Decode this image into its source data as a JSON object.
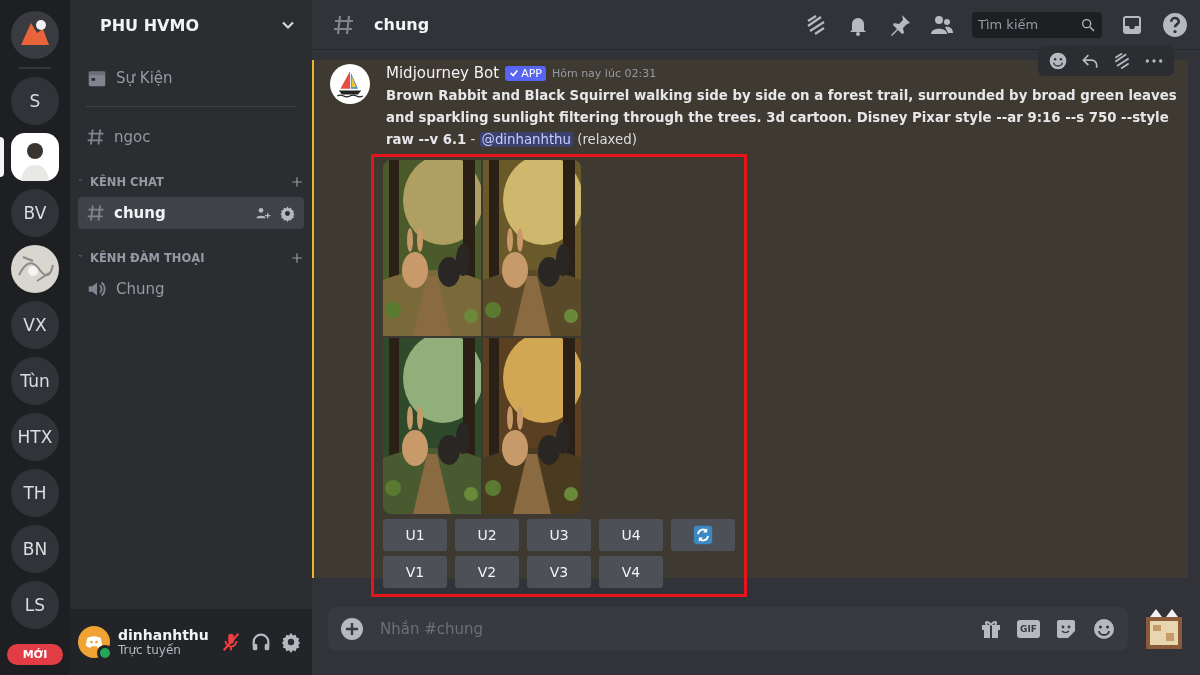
{
  "server_rail": {
    "items": [
      {
        "kind": "picture",
        "selected": false
      },
      {
        "kind": "divider"
      },
      {
        "kind": "text",
        "label": "S",
        "selected": false
      },
      {
        "kind": "picture",
        "selected": true
      },
      {
        "kind": "text",
        "label": "BV",
        "selected": false
      },
      {
        "kind": "picture",
        "selected": false
      },
      {
        "kind": "text",
        "label": "VX",
        "selected": false
      },
      {
        "kind": "text",
        "label": "Tùn",
        "selected": false
      },
      {
        "kind": "text",
        "label": "HTX",
        "selected": false
      },
      {
        "kind": "text",
        "label": "TH",
        "selected": false
      },
      {
        "kind": "text",
        "label": "BN",
        "selected": false
      },
      {
        "kind": "text",
        "label": "LS",
        "selected": false
      }
    ],
    "new_badge": "MỚI"
  },
  "sidebar": {
    "server_name": "PHU HVMO",
    "items": [
      {
        "kind": "events",
        "label": "Sự Kiện"
      },
      {
        "kind": "divider"
      },
      {
        "kind": "text_channel",
        "label": "ngoc",
        "selected": false
      },
      {
        "kind": "category",
        "label": "KÊNH CHAT",
        "expanded": true,
        "children": [
          {
            "kind": "text_channel",
            "label": "chung",
            "selected": true
          }
        ]
      },
      {
        "kind": "category",
        "label": "KÊNH ĐÀM THOẠI",
        "expanded": true,
        "children": [
          {
            "kind": "voice_channel",
            "label": "Chung",
            "selected": false
          }
        ]
      }
    ]
  },
  "user_panel": {
    "name": "dinhanhthu",
    "status": "Trực tuyến",
    "online": true,
    "mic_muted": true
  },
  "header": {
    "channel": "chung",
    "search": {
      "placeholder": "Tìm kiếm"
    }
  },
  "message": {
    "highlighted": true,
    "author": "Midjourney Bot",
    "badge": "APP",
    "time": "Hôm nay lúc 02:31",
    "content": "**Brown Rabbit and Black Squirrel walking side by side on a forest trail, surrounded by broad green leaves and sparkling sunlight filtering through the trees. 3d cartoon. Disney Pixar style --ar 9:16 --s 750 --style raw --v 6.1** -",
    "mention": "@dinhanhthu",
    "suffix": "(relaxed)",
    "images": [
      {
        "kind": "picture"
      },
      {
        "kind": "picture"
      },
      {
        "kind": "picture"
      },
      {
        "kind": "picture"
      }
    ],
    "buttons": [
      [
        {
          "kind": "text",
          "label": "U1"
        },
        {
          "kind": "text",
          "label": "U2"
        },
        {
          "kind": "text",
          "label": "U3"
        },
        {
          "kind": "text",
          "label": "U4"
        },
        {
          "kind": "reroll"
        }
      ],
      [
        {
          "kind": "text",
          "label": "V1"
        },
        {
          "kind": "text",
          "label": "V2"
        },
        {
          "kind": "text",
          "label": "V3"
        },
        {
          "kind": "text",
          "label": "V4"
        }
      ]
    ],
    "highlight_frame": true
  },
  "composer": {
    "placeholder": "Nhắn #chung",
    "gif_label": "GIF"
  }
}
